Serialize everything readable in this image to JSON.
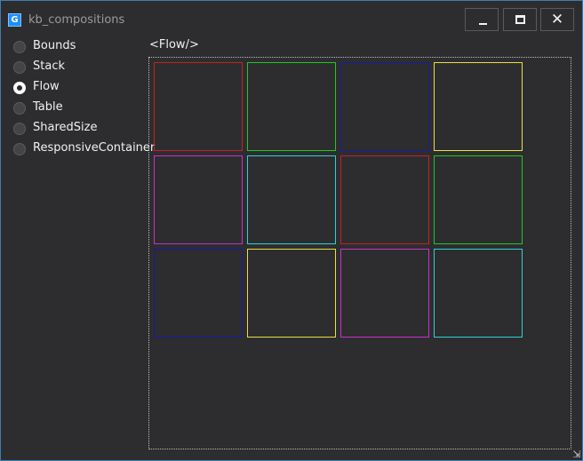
{
  "window": {
    "title": "kb_compositions",
    "app_icon_glyph": "G",
    "close_glyph": "✕"
  },
  "radio_options": [
    {
      "label": "Bounds",
      "checked": false
    },
    {
      "label": "Stack",
      "checked": false
    },
    {
      "label": "Flow",
      "checked": true
    },
    {
      "label": "Table",
      "checked": false
    },
    {
      "label": "SharedSize",
      "checked": false
    },
    {
      "label": "ResponsiveContainer",
      "checked": false
    }
  ],
  "flow": {
    "label": "<Flow/>",
    "boxes": [
      {
        "color": "#c82020"
      },
      {
        "color": "#22c822"
      },
      {
        "color": "#1a1aa0"
      },
      {
        "color": "#e8e040"
      },
      {
        "color": "#c832c8"
      },
      {
        "color": "#30d0d0"
      },
      {
        "color": "#c82020"
      },
      {
        "color": "#22c822"
      },
      {
        "color": "#1a1aa0"
      },
      {
        "color": "#e8e040"
      },
      {
        "color": "#c832c8"
      },
      {
        "color": "#30d0d0"
      }
    ]
  },
  "resize_grip_glyph": "⇲"
}
